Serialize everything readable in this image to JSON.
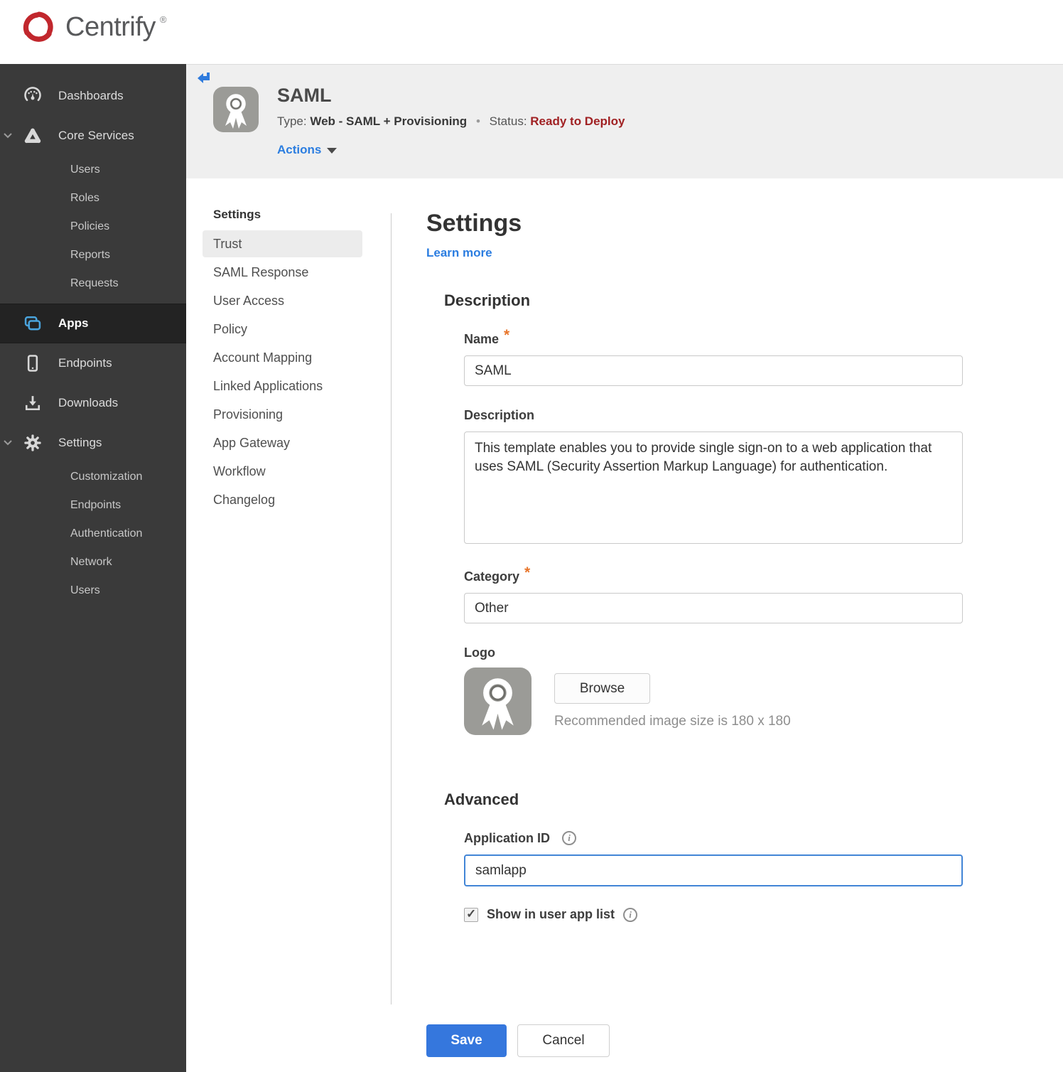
{
  "brand": {
    "name": "Centrify",
    "registered": "®"
  },
  "sidebar": {
    "dashboards": "Dashboards",
    "core_services": "Core Services",
    "core_children": [
      "Users",
      "Roles",
      "Policies",
      "Reports",
      "Requests"
    ],
    "apps": "Apps",
    "endpoints": "Endpoints",
    "downloads": "Downloads",
    "settings": "Settings",
    "settings_children": [
      "Customization",
      "Endpoints",
      "Authentication",
      "Network",
      "Users"
    ]
  },
  "header": {
    "app_title": "SAML",
    "type_label": "Type:",
    "type_value": "Web - SAML + Provisioning",
    "separator": "•",
    "status_label": "Status:",
    "status_value": "Ready to Deploy",
    "actions_label": "Actions"
  },
  "subnav": {
    "heading": "Settings",
    "active_item": "Trust",
    "items": [
      "Trust",
      "SAML Response",
      "User Access",
      "Policy",
      "Account Mapping",
      "Linked Applications",
      "Provisioning",
      "App Gateway",
      "Workflow",
      "Changelog"
    ]
  },
  "main": {
    "title": "Settings",
    "learn_more": "Learn more",
    "description_section": {
      "heading": "Description",
      "name_label": "Name",
      "required_marker": "*",
      "name_value": "SAML",
      "description_label": "Description",
      "description_value": "This template enables you to provide single sign-on to a web application that uses SAML (Security Assertion Markup Language) for authentication.",
      "category_label": "Category",
      "category_value": "Other",
      "logo_label": "Logo",
      "browse_button": "Browse",
      "logo_hint": "Recommended image size is 180 x 180"
    },
    "advanced_section": {
      "heading": "Advanced",
      "application_id_label": "Application ID",
      "application_id_value": "samlapp",
      "show_in_user_app_list_label": "Show in user app list",
      "checkbox_checked": true
    },
    "footer": {
      "save_button": "Save",
      "cancel_button": "Cancel"
    }
  },
  "colors": {
    "accent_blue": "#3577dd",
    "link_blue": "#2b7de0",
    "focused_input_blue": "#4285d6",
    "apps_icon_blue": "#4aa4dd",
    "status_red": "#a02123",
    "logo_red": "#c1272d",
    "required_orange": "#e8762c",
    "sidebar_bg": "#3a3a3a",
    "sidebar_active_bg": "#232323",
    "header_band_bg": "#efefef",
    "active_subnav_bg": "#ececec"
  }
}
